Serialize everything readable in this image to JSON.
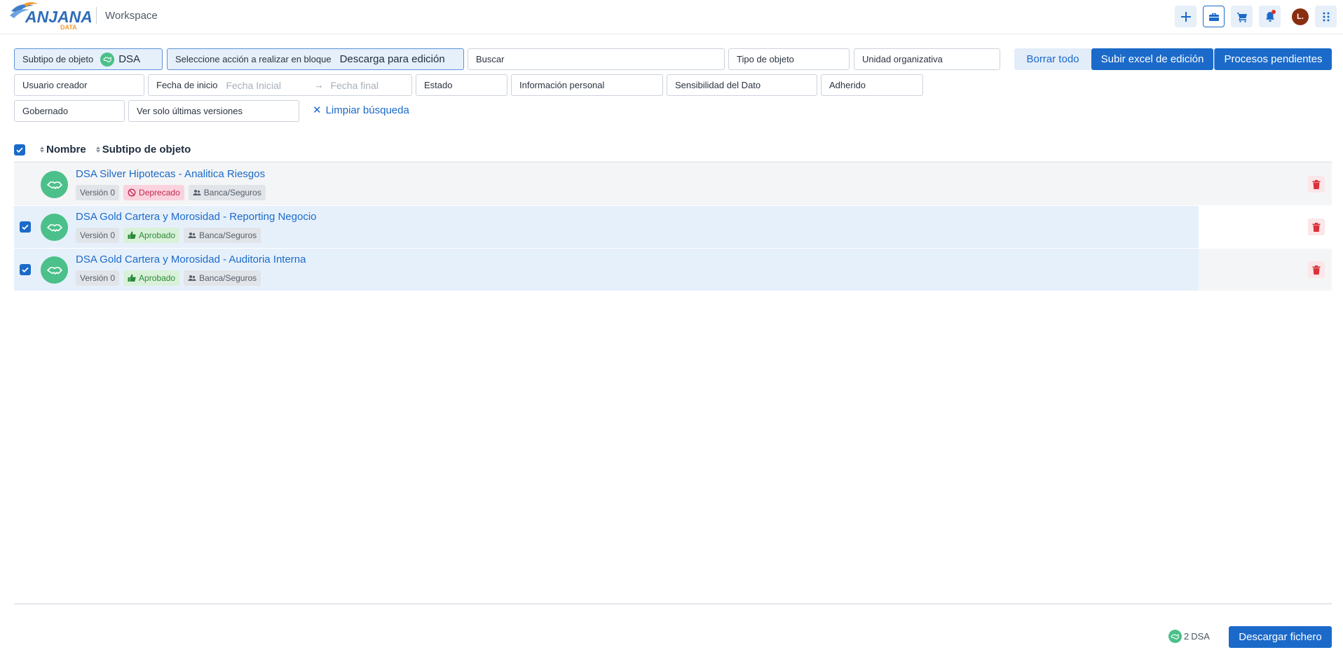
{
  "header": {
    "logo_text": "ANJANA",
    "logo_sub": "DATA",
    "title": "Workspace",
    "avatar_initial": "L."
  },
  "filters": {
    "subtype_label": "Subtipo de objeto",
    "subtype_value": "DSA",
    "bulk_action_label": "Seleccione acción a realizar en bloque",
    "bulk_action_value": "Descarga para edición",
    "search_label": "Buscar",
    "object_type_label": "Tipo de objeto",
    "org_unit_label": "Unidad organizativa",
    "creator_label": "Usuario creador",
    "start_date_label": "Fecha de inicio",
    "start_date_placeholder": "Fecha Inicial",
    "end_date_placeholder": "Fecha final",
    "state_label": "Estado",
    "personal_info_label": "Información personal",
    "sensitivity_label": "Sensibilidad del Dato",
    "adhered_label": "Adherido",
    "governed_label": "Gobernado",
    "latest_versions_label": "Ver solo últimas versiones",
    "clear_search_label": "Limpiar búsqueda"
  },
  "actions": {
    "clear_all": "Borrar todo",
    "upload_excel": "Subir excel de edición",
    "pending_processes": "Procesos pendientes"
  },
  "table": {
    "columns": [
      "Nombre",
      "Subtipo de objeto"
    ],
    "rows": [
      {
        "name": "DSA Silver Hipotecas - Analitica Riesgos",
        "version": "Versión 0",
        "status": "Deprecado",
        "group": "Banca/Seguros",
        "checked": false
      },
      {
        "name": "DSA Gold Cartera y Morosidad - Reporting Negocio",
        "version": "Versión 0",
        "status": "Aprobado",
        "group": "Banca/Seguros",
        "checked": true
      },
      {
        "name": "DSA Gold Cartera y Morosidad - Auditoria Interna",
        "version": "Versión 0",
        "status": "Aprobado",
        "group": "Banca/Seguros",
        "checked": true
      }
    ]
  },
  "footer": {
    "count": "2",
    "count_type": "DSA",
    "download_label": "Descargar fichero"
  },
  "colors": {
    "primary": "#1b6ac9",
    "dsa_green": "#4bc08a",
    "deprecated": "#c2264f",
    "approved": "#2c8a3a"
  }
}
